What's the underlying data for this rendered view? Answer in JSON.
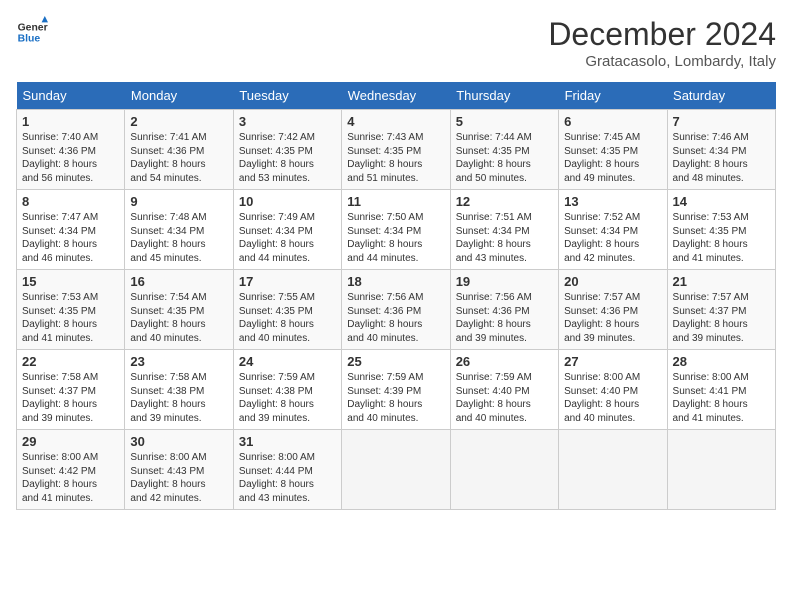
{
  "header": {
    "logo_line1": "General",
    "logo_line2": "Blue",
    "month": "December 2024",
    "location": "Gratacasolo, Lombardy, Italy"
  },
  "days_of_week": [
    "Sunday",
    "Monday",
    "Tuesday",
    "Wednesday",
    "Thursday",
    "Friday",
    "Saturday"
  ],
  "weeks": [
    [
      {
        "day": "1",
        "sunrise": "7:40 AM",
        "sunset": "4:36 PM",
        "daylight": "8 hours and 56 minutes."
      },
      {
        "day": "2",
        "sunrise": "7:41 AM",
        "sunset": "4:36 PM",
        "daylight": "8 hours and 54 minutes."
      },
      {
        "day": "3",
        "sunrise": "7:42 AM",
        "sunset": "4:35 PM",
        "daylight": "8 hours and 53 minutes."
      },
      {
        "day": "4",
        "sunrise": "7:43 AM",
        "sunset": "4:35 PM",
        "daylight": "8 hours and 51 minutes."
      },
      {
        "day": "5",
        "sunrise": "7:44 AM",
        "sunset": "4:35 PM",
        "daylight": "8 hours and 50 minutes."
      },
      {
        "day": "6",
        "sunrise": "7:45 AM",
        "sunset": "4:35 PM",
        "daylight": "8 hours and 49 minutes."
      },
      {
        "day": "7",
        "sunrise": "7:46 AM",
        "sunset": "4:34 PM",
        "daylight": "8 hours and 48 minutes."
      }
    ],
    [
      {
        "day": "8",
        "sunrise": "7:47 AM",
        "sunset": "4:34 PM",
        "daylight": "8 hours and 46 minutes."
      },
      {
        "day": "9",
        "sunrise": "7:48 AM",
        "sunset": "4:34 PM",
        "daylight": "8 hours and 45 minutes."
      },
      {
        "day": "10",
        "sunrise": "7:49 AM",
        "sunset": "4:34 PM",
        "daylight": "8 hours and 44 minutes."
      },
      {
        "day": "11",
        "sunrise": "7:50 AM",
        "sunset": "4:34 PM",
        "daylight": "8 hours and 44 minutes."
      },
      {
        "day": "12",
        "sunrise": "7:51 AM",
        "sunset": "4:34 PM",
        "daylight": "8 hours and 43 minutes."
      },
      {
        "day": "13",
        "sunrise": "7:52 AM",
        "sunset": "4:34 PM",
        "daylight": "8 hours and 42 minutes."
      },
      {
        "day": "14",
        "sunrise": "7:53 AM",
        "sunset": "4:35 PM",
        "daylight": "8 hours and 41 minutes."
      }
    ],
    [
      {
        "day": "15",
        "sunrise": "7:53 AM",
        "sunset": "4:35 PM",
        "daylight": "8 hours and 41 minutes."
      },
      {
        "day": "16",
        "sunrise": "7:54 AM",
        "sunset": "4:35 PM",
        "daylight": "8 hours and 40 minutes."
      },
      {
        "day": "17",
        "sunrise": "7:55 AM",
        "sunset": "4:35 PM",
        "daylight": "8 hours and 40 minutes."
      },
      {
        "day": "18",
        "sunrise": "7:56 AM",
        "sunset": "4:36 PM",
        "daylight": "8 hours and 40 minutes."
      },
      {
        "day": "19",
        "sunrise": "7:56 AM",
        "sunset": "4:36 PM",
        "daylight": "8 hours and 39 minutes."
      },
      {
        "day": "20",
        "sunrise": "7:57 AM",
        "sunset": "4:36 PM",
        "daylight": "8 hours and 39 minutes."
      },
      {
        "day": "21",
        "sunrise": "7:57 AM",
        "sunset": "4:37 PM",
        "daylight": "8 hours and 39 minutes."
      }
    ],
    [
      {
        "day": "22",
        "sunrise": "7:58 AM",
        "sunset": "4:37 PM",
        "daylight": "8 hours and 39 minutes."
      },
      {
        "day": "23",
        "sunrise": "7:58 AM",
        "sunset": "4:38 PM",
        "daylight": "8 hours and 39 minutes."
      },
      {
        "day": "24",
        "sunrise": "7:59 AM",
        "sunset": "4:38 PM",
        "daylight": "8 hours and 39 minutes."
      },
      {
        "day": "25",
        "sunrise": "7:59 AM",
        "sunset": "4:39 PM",
        "daylight": "8 hours and 40 minutes."
      },
      {
        "day": "26",
        "sunrise": "7:59 AM",
        "sunset": "4:40 PM",
        "daylight": "8 hours and 40 minutes."
      },
      {
        "day": "27",
        "sunrise": "8:00 AM",
        "sunset": "4:40 PM",
        "daylight": "8 hours and 40 minutes."
      },
      {
        "day": "28",
        "sunrise": "8:00 AM",
        "sunset": "4:41 PM",
        "daylight": "8 hours and 41 minutes."
      }
    ],
    [
      {
        "day": "29",
        "sunrise": "8:00 AM",
        "sunset": "4:42 PM",
        "daylight": "8 hours and 41 minutes."
      },
      {
        "day": "30",
        "sunrise": "8:00 AM",
        "sunset": "4:43 PM",
        "daylight": "8 hours and 42 minutes."
      },
      {
        "day": "31",
        "sunrise": "8:00 AM",
        "sunset": "4:44 PM",
        "daylight": "8 hours and 43 minutes."
      },
      null,
      null,
      null,
      null
    ]
  ]
}
